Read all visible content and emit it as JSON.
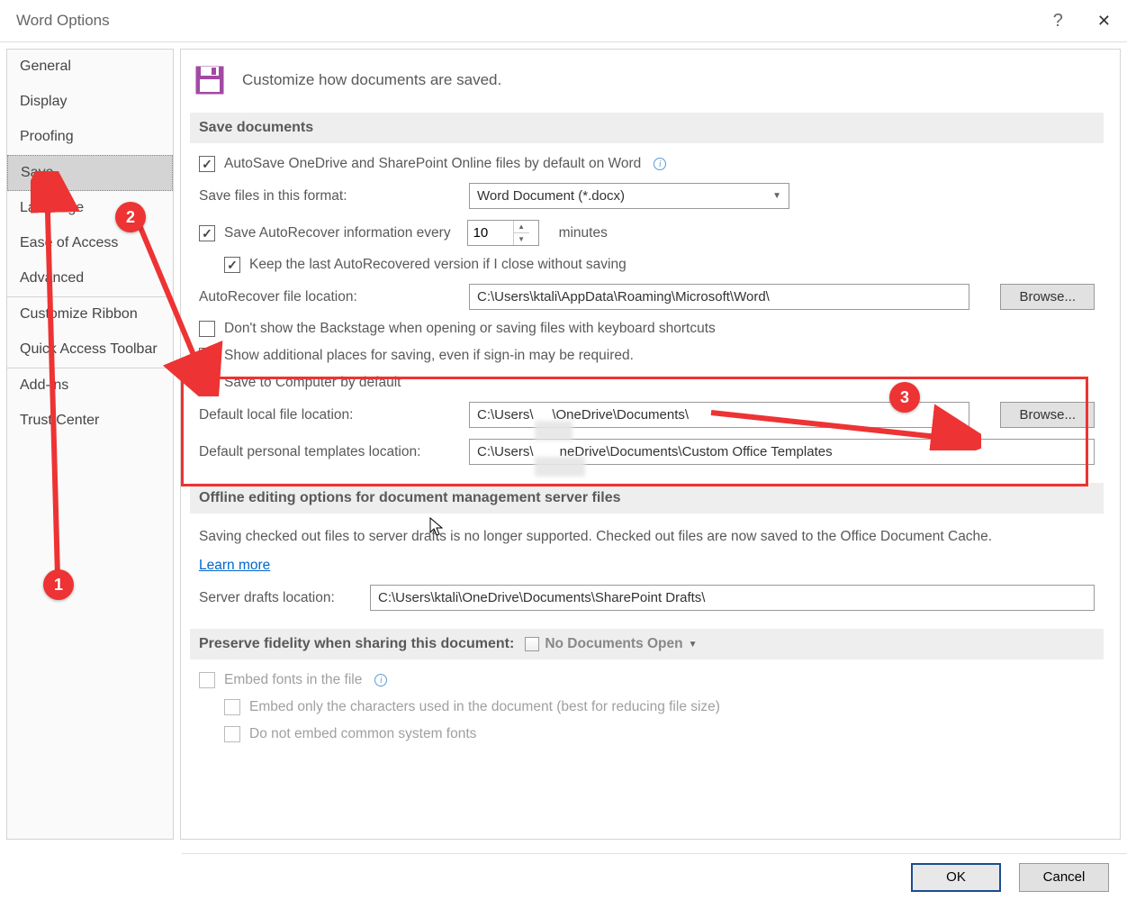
{
  "title": "Word Options",
  "sidebar": {
    "items": [
      {
        "label": "General"
      },
      {
        "label": "Display"
      },
      {
        "label": "Proofing"
      },
      {
        "label": "Save"
      },
      {
        "label": "Language"
      },
      {
        "label": "Ease of Access"
      },
      {
        "label": "Advanced"
      },
      {
        "label": "Customize Ribbon"
      },
      {
        "label": "Quick Access Toolbar"
      },
      {
        "label": "Add-ins"
      },
      {
        "label": "Trust Center"
      }
    ],
    "selected_index": 3
  },
  "header": {
    "text": "Customize how documents are saved."
  },
  "section_save": {
    "title": "Save documents",
    "autosave": "AutoSave OneDrive and SharePoint Online files by default on Word",
    "format_label": "Save files in this format:",
    "format_value": "Word Document (*.docx)",
    "autorecover_label": "Save AutoRecover information every",
    "autorecover_value": "10",
    "autorecover_unit": "minutes",
    "keep_last": "Keep the last AutoRecovered version if I close without saving",
    "autorecover_loc_label": "AutoRecover file location:",
    "autorecover_loc_value": "C:\\Users\\ktali\\AppData\\Roaming\\Microsoft\\Word\\",
    "browse1": "Browse...",
    "dont_show_backstage": "Don't show the Backstage when opening or saving files with keyboard shortcuts",
    "show_additional": "Show additional places for saving, even if sign-in may be required.",
    "save_computer": "Save to Computer by default",
    "default_local_label": "Default local file location:",
    "default_local_value": "C:\\Users\\     \\OneDrive\\Documents\\",
    "browse2": "Browse...",
    "default_templates_label": "Default personal templates location:",
    "default_templates_value": "C:\\Users\\       neDrive\\Documents\\Custom Office Templates"
  },
  "section_offline": {
    "title": "Offline editing options for document management server files",
    "note": "Saving checked out files to server drafts is no longer supported. Checked out files are now saved to the Office Document Cache.",
    "learn": "Learn more",
    "drafts_label": "Server drafts location:",
    "drafts_value": "C:\\Users\\ktali\\OneDrive\\Documents\\SharePoint Drafts\\"
  },
  "section_fidelity": {
    "title": "Preserve fidelity when sharing this document:",
    "doc_combo": "No Documents Open",
    "embed_fonts": "Embed fonts in the file",
    "embed_chars": "Embed only the characters used in the document (best for reducing file size)",
    "embed_common": "Do not embed common system fonts"
  },
  "buttons": {
    "ok": "OK",
    "cancel": "Cancel"
  },
  "annotations": {
    "b1": "1",
    "b2": "2",
    "b3": "3"
  }
}
